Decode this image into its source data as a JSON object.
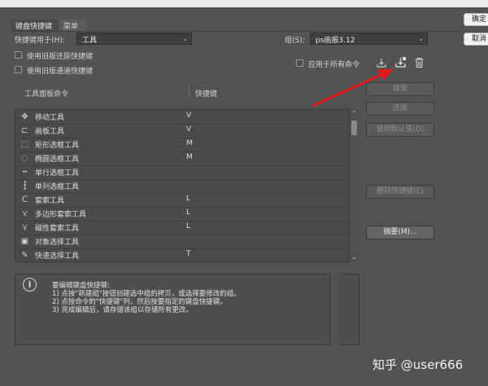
{
  "tabs": [
    {
      "label": "键盘快捷键",
      "active": true
    },
    {
      "label": "菜单",
      "active": false
    }
  ],
  "shortcuts_for": {
    "label": "快捷键用于(H):",
    "value": "工具"
  },
  "set": {
    "label": "组(S):",
    "value": "ps画报3.12"
  },
  "options": {
    "legacy_undo": "使用旧版还原快捷键",
    "legacy_channel": "使用旧版通道快捷键",
    "apply_all": "应用于所有命令"
  },
  "columns": {
    "command": "工具面板命令",
    "shortcut": "快捷键"
  },
  "tools": [
    {
      "name": "移动工具",
      "shortcut": "V",
      "icon": "move-icon",
      "glyph": "✥"
    },
    {
      "name": "画板工具",
      "shortcut": "V",
      "icon": "artboard-icon",
      "glyph": "⊏"
    },
    {
      "name": "矩形选框工具",
      "shortcut": "M",
      "icon": "rect-marquee-icon",
      "glyph": "⬚"
    },
    {
      "name": "椭圆选框工具",
      "shortcut": "M",
      "icon": "ellipse-marquee-icon",
      "glyph": "◌"
    },
    {
      "name": "单行选框工具",
      "shortcut": "",
      "icon": "single-row-marquee-icon",
      "glyph": "┅"
    },
    {
      "name": "单列选框工具",
      "shortcut": "",
      "icon": "single-column-marquee-icon",
      "glyph": "┇"
    },
    {
      "name": "套索工具",
      "shortcut": "L",
      "icon": "lasso-icon",
      "glyph": "ᑕ"
    },
    {
      "name": "多边形套索工具",
      "shortcut": "L",
      "icon": "polygonal-lasso-icon",
      "glyph": "⋎"
    },
    {
      "name": "磁性套索工具",
      "shortcut": "L",
      "icon": "magnetic-lasso-icon",
      "glyph": "⋎"
    },
    {
      "name": "对象选择工具",
      "shortcut": "",
      "icon": "object-selection-icon",
      "glyph": "▣"
    },
    {
      "name": "快速选择工具",
      "shortcut": "T",
      "icon": "quick-selection-icon",
      "glyph": "✎"
    }
  ],
  "buttons": {
    "accept": "接受",
    "undo": "还原",
    "use_default": "使用默认值(D)",
    "delete_shortcut": "删除快捷键(E)",
    "summarize": "摘要(M)..."
  },
  "side_buttons": {
    "ok": "确定",
    "cancel": "取消"
  },
  "info": {
    "lines": [
      "要编辑键盘快捷键:",
      "1) 点按\"新建组\"按钮创建选中组的拷贝，或选择要修改的组。",
      "2) 点按命令的\"快捷键\"列，然后按要指定的键盘快捷键。",
      "3) 完成编辑后，请存储该组以存储所有更改。"
    ]
  },
  "watermark": "知乎 @user666",
  "colors": {
    "arrow": "#e31b1b",
    "dialog_bg": "#535353"
  }
}
